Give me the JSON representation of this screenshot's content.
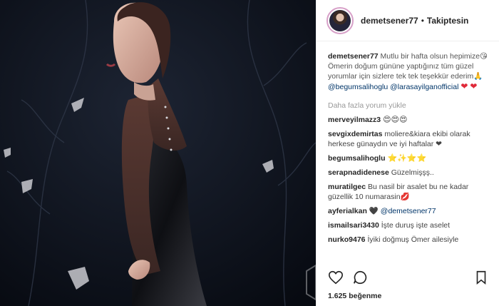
{
  "post": {
    "username": "demetsener77",
    "follow_status": "Takiptesin",
    "dot": "•",
    "caption_text": "Mutlu bir hafta olsun hepimize😘Ömerin doğum gününe yaptığınız tüm güzel yorumlar için sizlere tek tek teşekkür ederim🙏",
    "mention1": "@begumsalihoglu",
    "mention2": "@larasayilganofficial",
    "load_more": "Daha fazla yorum yükle",
    "likes": "1.625 beğenme"
  },
  "comments": [
    {
      "user": "merveyilmazz3",
      "text": "😍😍😍"
    },
    {
      "user": "sevgixdemirtas",
      "text": "moliere&kiara ekibi olarak herkese günaydın ve iyi haftalar ❤"
    },
    {
      "user": "begumsalihoglu",
      "text": "⭐✨⭐⭐"
    },
    {
      "user": "serapnadidenese",
      "text": "Güzelmişşş.."
    },
    {
      "user": "muratilgec",
      "text": "Bu nasil bir asalet bu ne kadar güzellik 10 numarasin💋"
    },
    {
      "user": "ayferialkan",
      "text": "🖤",
      "mention": "@demetsener77"
    },
    {
      "user": "ismailsari3430",
      "text": "İşte duruş işte aselet"
    },
    {
      "user": "nurko9476",
      "text": "İyiki doğmuş Ömer ailesiyle"
    }
  ],
  "colors": {
    "mention": "#003569",
    "heart": "#e02a3a",
    "muted": "#999999"
  },
  "icons": [
    "like-heart-icon",
    "comment-icon",
    "bookmark-icon"
  ]
}
